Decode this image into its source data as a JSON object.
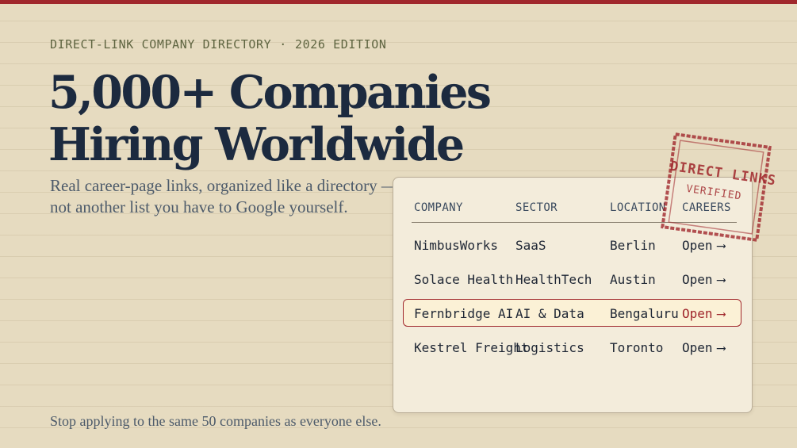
{
  "kicker": {
    "label": "DIRECT-LINK COMPANY DIRECTORY",
    "separator": "·",
    "edition": "2026 EDITION"
  },
  "headline": {
    "line1": "5,000+ Companies",
    "line2": "Hiring Worldwide"
  },
  "subhead": {
    "line1": "Real career-page links, organized like a directory —",
    "line2": "not another list you have to Google yourself."
  },
  "directory": {
    "columns": [
      "COMPANY",
      "SECTOR",
      "LOCATION",
      "CAREERS"
    ],
    "rows": [
      {
        "company": "NimbusWorks",
        "sector": "SaaS",
        "location": "Berlin",
        "careers": "Open",
        "highlighted": false
      },
      {
        "company": "Solace Health",
        "sector": "HealthTech",
        "location": "Austin",
        "careers": "Open",
        "highlighted": false
      },
      {
        "company": "Fernbridge AI",
        "sector": "AI & Data",
        "location": "Bengaluru",
        "careers": "Open",
        "highlighted": true
      },
      {
        "company": "Kestrel Freight",
        "sector": "Logistics",
        "location": "Toronto",
        "careers": "Open",
        "highlighted": false
      }
    ],
    "arrow": "⟶"
  },
  "stamp": {
    "main": "DIRECT LINKS",
    "sub": "VERIFIED"
  },
  "footer": {
    "text": "Stop applying to the same 50 companies as everyone else."
  },
  "colors": {
    "accent": "#a0272c",
    "ink": "#1c2a3f",
    "paper": "#e6dbc0",
    "card": "#f3ecdb",
    "highlight_fill": "#fbf1d6",
    "kicker": "#5e6440"
  }
}
